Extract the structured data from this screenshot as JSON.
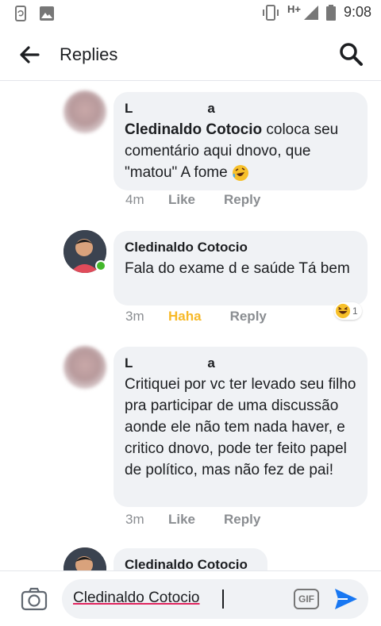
{
  "status_bar": {
    "time": "9:08",
    "network": "H+"
  },
  "app_bar": {
    "title": "Replies"
  },
  "comments": [
    {
      "author_prefix": "L",
      "author_suffix": "a",
      "mention": "Cledinaldo Cotocio",
      "text": " coloca seu comentário aqui dnovo, que \"matou\" A fome",
      "emoji": "rolling-on-floor-laughing-emoji",
      "time": "4m",
      "like": "Like",
      "reply": "Reply"
    },
    {
      "author": "Cledinaldo Cotocio",
      "text": "Fala do exame  d e saúde Tá bem",
      "time": "3m",
      "like": "Haha",
      "reply": "Reply",
      "reaction_count": "1"
    },
    {
      "author_prefix": "L",
      "author_suffix": "a",
      "text": "Critiquei por vc ter levado seu filho pra participar de uma discussão aonde ele não tem nada haver, e critico dnovo, pode ter feito papel de político, mas não fez de pai!",
      "time": "3m",
      "like": "Like",
      "reply": "Reply"
    },
    {
      "author": "Cledinaldo Cotocio"
    }
  ],
  "composer": {
    "value": "Cledinaldo Cotocio",
    "gif_label": "GIF"
  },
  "colors": {
    "accent": "#1877f2",
    "haha": "#f7b928",
    "bubble": "#f0f2f5",
    "online": "#42b72a"
  }
}
